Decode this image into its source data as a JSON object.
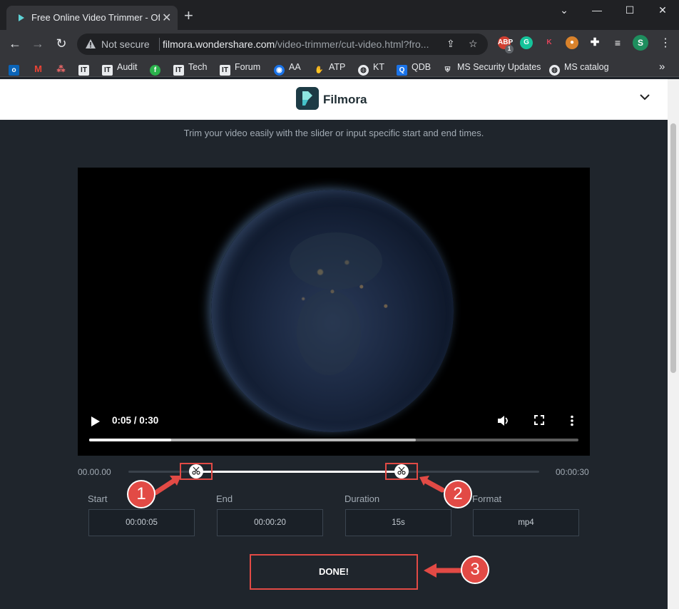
{
  "browser": {
    "tab_title": "Free Online Video Trimmer - Offe",
    "tab_close": "✕",
    "new_tab": "+",
    "window_controls": {
      "minimize": "—",
      "maximize": "☐",
      "close": "✕",
      "tabsearch": "⌄"
    },
    "security_label": "Not secure",
    "url_host": "filmora.wondershare.com",
    "url_path": "/video-trimmer/cut-video.html?fro...",
    "profile_initial": "S",
    "extension_badge": "1",
    "bookmarks": [
      {
        "label": "",
        "icon": "outlook-icon"
      },
      {
        "label": "",
        "icon": "gmail-icon"
      },
      {
        "label": "",
        "icon": "asana-icon"
      },
      {
        "label": "",
        "icon": "it-icon"
      },
      {
        "label": "Audit",
        "icon": "it-icon"
      },
      {
        "label": "",
        "icon": "feedly-icon"
      },
      {
        "label": "Tech",
        "icon": "it-icon"
      },
      {
        "label": "Forum",
        "icon": "it-icon"
      },
      {
        "label": "AA",
        "icon": "eye-icon"
      },
      {
        "label": "ATP",
        "icon": "hand-icon"
      },
      {
        "label": "KT",
        "icon": "globe-icon"
      },
      {
        "label": "QDB",
        "icon": "q-icon"
      },
      {
        "label": "MS Security Updates",
        "icon": "shield-icon"
      },
      {
        "label": "MS catalog",
        "icon": "globe-icon"
      }
    ],
    "more_bookmarks": "»"
  },
  "site": {
    "brand": "Filmora",
    "subtitle": "Trim your video easily with the slider or input specific start and end times."
  },
  "video": {
    "time_display": "0:05 / 0:30",
    "played_fraction": 0.167,
    "buffered_fraction": 0.667
  },
  "trim": {
    "timeline_start": "00.00.00",
    "timeline_end": "00:00:30",
    "start_fraction": 0.167,
    "end_fraction": 0.667,
    "fields": [
      {
        "label": "Start",
        "value": "00:00:05"
      },
      {
        "label": "End",
        "value": "00:00:20"
      },
      {
        "label": "Duration",
        "value": "15s"
      },
      {
        "label": "Format",
        "value": "mp4"
      }
    ],
    "done_label": "DONE!"
  },
  "annotations": {
    "callout_1": "1",
    "callout_2": "2",
    "callout_3": "3",
    "color": "#e24a45"
  }
}
